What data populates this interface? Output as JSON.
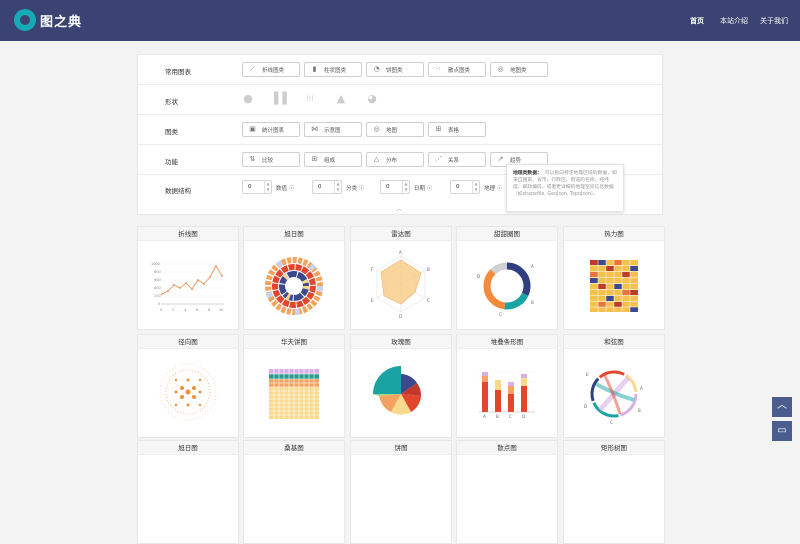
{
  "header": {
    "logo_text": "图之典",
    "nav": [
      "首页",
      "本站介绍",
      "关于我们"
    ]
  },
  "filters": {
    "rows": [
      {
        "label": "常用图表",
        "chips": [
          {
            "text": "折线图类",
            "icon": "line-chart-icon"
          },
          {
            "text": "柱状图类",
            "icon": "bar-chart-icon"
          },
          {
            "text": "饼图类",
            "icon": "pie-chart-icon"
          },
          {
            "text": "散点图类",
            "icon": "scatter-chart-icon"
          },
          {
            "text": "地图类",
            "icon": "globe-icon"
          }
        ]
      },
      {
        "label": "形状",
        "shapes": [
          "circle-shape-icon",
          "bars-shape-icon",
          "dots-shape-icon",
          "area-shape-icon",
          "globe-shape-icon"
        ]
      },
      {
        "label": "图类",
        "chips": [
          {
            "text": "统计图表",
            "icon": "stats-icon"
          },
          {
            "text": "示意图",
            "icon": "diagram-icon"
          },
          {
            "text": "地图",
            "icon": "map-icon"
          },
          {
            "text": "表格",
            "icon": "table-icon"
          }
        ]
      },
      {
        "label": "功能",
        "chips": [
          {
            "text": "比较",
            "icon": "compare-icon"
          },
          {
            "text": "组成",
            "icon": "composition-icon"
          },
          {
            "text": "分布",
            "icon": "distribution-icon"
          },
          {
            "text": "关系",
            "icon": "relation-icon"
          },
          {
            "text": "趋势",
            "icon": "trend-icon"
          }
        ]
      },
      {
        "label": "数据结构",
        "steppers": [
          {
            "value": "0",
            "label": "数值"
          },
          {
            "value": "0",
            "label": "分类"
          },
          {
            "value": "0",
            "label": "日期"
          },
          {
            "value": "0",
            "label": "地理"
          }
        ]
      }
    ]
  },
  "tooltip": {
    "title": "地理类数据：",
    "body": "可以指向特定地理区域的数据，如来自国家、省市、行政区、街道的名称、经纬度、邮政编码，或者更详细的地理空间信息数据（如shapefile, GeoJson, TopoJson）。"
  },
  "cards": [
    {
      "title": "折线图"
    },
    {
      "title": "旭日图"
    },
    {
      "title": "雷达图"
    },
    {
      "title": "甜甜圈图"
    },
    {
      "title": "热力图"
    },
    {
      "title": "径向图"
    },
    {
      "title": "华夫饼图"
    },
    {
      "title": "玫瑰图"
    },
    {
      "title": "堆叠条形图"
    },
    {
      "title": "和弦图"
    },
    {
      "title": "旭日图"
    },
    {
      "title": "桑基图"
    },
    {
      "title": "饼图"
    },
    {
      "title": "散点图"
    },
    {
      "title": "矩形树图"
    }
  ],
  "thumbnails": {
    "line": {
      "y_ticks": [
        "1000",
        "800",
        "600",
        "400",
        "200",
        "0"
      ],
      "x_ticks": [
        "0",
        "2",
        "4",
        "6",
        "8",
        "10"
      ]
    },
    "radar": {
      "labels": [
        "A",
        "B",
        "C",
        "D",
        "E",
        "F"
      ]
    },
    "donut": {
      "labels": [
        "A",
        "B",
        "C",
        "D"
      ]
    },
    "stacked": {
      "labels": [
        "A",
        "B",
        "C",
        "D"
      ]
    },
    "chord": {
      "labels": [
        "A",
        "B",
        "C",
        "D",
        "E"
      ]
    }
  }
}
